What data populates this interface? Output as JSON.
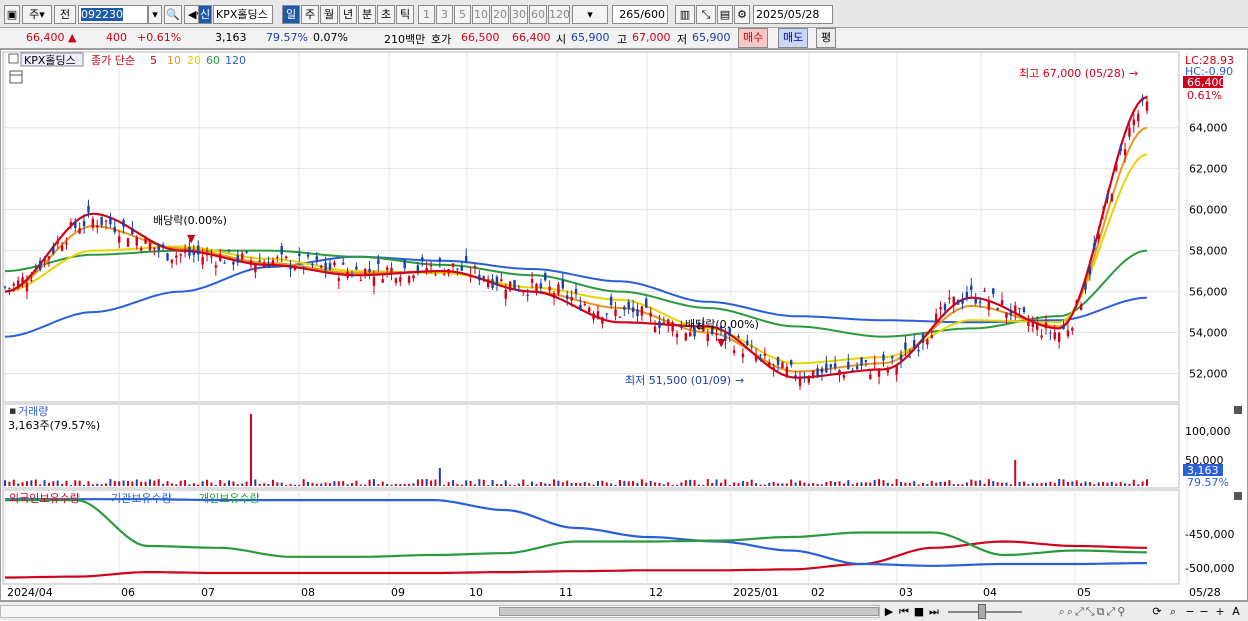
{
  "toolbar": {
    "mode1": "주",
    "mode2": "전",
    "code": "092230",
    "new_badge": "신",
    "stock_name": "KPX홀딩스",
    "periods": [
      "일",
      "주",
      "월",
      "년",
      "분",
      "초",
      "틱"
    ],
    "intervals": [
      "1",
      "3",
      "5",
      "10",
      "20",
      "30",
      "60",
      "120"
    ],
    "count": "265",
    "count_total": "/600",
    "date": "2025/05/28"
  },
  "info": {
    "price": "66,400",
    "arrow": "▲",
    "change": "400",
    "change_pct": "+0.61%",
    "volume": "3,163",
    "vol_ratio": "79.57%",
    "turnover_pct": "0.07%",
    "amount": "210백만",
    "quote_label": "호가",
    "ask": "66,500",
    "bid": "66,400",
    "open_label": "시",
    "open": "65,900",
    "high_label": "고",
    "high": "67,000",
    "low_label": "저",
    "low": "65,900",
    "buy_label": "매수",
    "sell_label": "매도",
    "eval_label": "평"
  },
  "price_panel": {
    "name_tag": "KPX홀딩스",
    "legend_prefix": "종가 단순",
    "ma_labels": [
      "5",
      "10",
      "20",
      "60",
      "120"
    ],
    "ma_colors": [
      "#d0021b",
      "#e8961e",
      "#e8d400",
      "#2a9a3c",
      "#2a5fd8"
    ],
    "lc_label": "LC:28.93",
    "hc_label": "HC:-0.90",
    "last_price_tag": "66,400",
    "last_pct": "0.61%",
    "high_marker": "최고 67,000 (05/28)",
    "low_marker": "최저 51,500 (01/09)",
    "dividend1": "배당락(0.00%)",
    "dividend2": "배당락(0.00%)",
    "y_ticks": [
      "64,000",
      "62,000",
      "60,000",
      "58,000",
      "56,000",
      "54,000",
      "52,000"
    ]
  },
  "volume_panel": {
    "title": "거래량",
    "current": "3,163주(79.57%)",
    "y_ticks": [
      "100,000",
      "50,000"
    ],
    "last_tag": "3,163",
    "last_pct": "79.57%"
  },
  "holdings_panel": {
    "labels": [
      "외국인보유수량",
      "기관보유수량",
      "개인보유수량"
    ],
    "colors": [
      "#d0021b",
      "#2a5fd8",
      "#2a9a3c"
    ],
    "y_ticks": [
      "-450,000",
      "-500,000"
    ]
  },
  "x_axis": [
    "2024/04",
    "06",
    "07",
    "08",
    "09",
    "10",
    "11",
    "12",
    "2025/01",
    "02",
    "03",
    "04",
    "05",
    "05/28"
  ],
  "chart_data": {
    "type": "candlestick",
    "x": [
      "2024/04",
      "2024/05",
      "2024/06",
      "2024/07",
      "2024/08",
      "2024/09",
      "2024/10",
      "2024/11",
      "2024/12",
      "2025/01",
      "2025/02",
      "2025/03",
      "2025/04",
      "2025/05"
    ],
    "series": [
      {
        "name": "종가",
        "values": [
          56200,
          59500,
          57800,
          57500,
          57000,
          57200,
          56200,
          55000,
          54000,
          52000,
          52300,
          55800,
          54000,
          65000
        ]
      },
      {
        "name": "5",
        "values": [
          56000,
          59800,
          58000,
          57300,
          56800,
          57000,
          56000,
          54500,
          54300,
          51800,
          52200,
          55700,
          54200,
          65500
        ]
      },
      {
        "name": "10",
        "values": [
          56000,
          59200,
          58100,
          57400,
          56900,
          57000,
          56000,
          55200,
          54000,
          52100,
          52500,
          55300,
          54300,
          64000
        ]
      },
      {
        "name": "20",
        "values": [
          56000,
          58000,
          58200,
          57600,
          57000,
          56900,
          56200,
          55600,
          54200,
          52500,
          52800,
          54600,
          54500,
          62700
        ]
      },
      {
        "name": "60",
        "values": [
          57000,
          57800,
          58000,
          58000,
          57700,
          57300,
          56800,
          56000,
          55200,
          54300,
          53800,
          54200,
          54800,
          58000
        ]
      },
      {
        "name": "120",
        "values": [
          53800,
          55000,
          56000,
          57200,
          57700,
          57500,
          57100,
          56500,
          55500,
          54800,
          54600,
          54500,
          54600,
          55700
        ]
      }
    ],
    "high": "67,000",
    "low": "51,500",
    "ylim": [
      51000,
      67500
    ]
  }
}
